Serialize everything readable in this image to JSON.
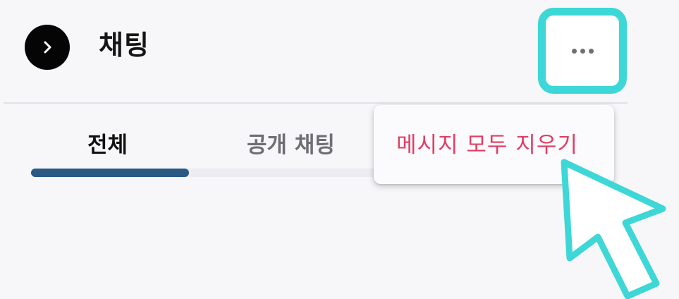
{
  "header": {
    "title": "채팅",
    "collapse_icon": "chevron-right-icon",
    "more_icon": "more-horizontal-icon"
  },
  "tabs": [
    {
      "label": "전체",
      "active": true
    },
    {
      "label": "공개 채팅",
      "active": false
    }
  ],
  "menu": {
    "items": [
      {
        "label": "메시지 모두 지우기",
        "color": "#e23d63"
      }
    ]
  },
  "annotations": {
    "highlight_color": "#3ed7d7",
    "cursor_icon": "pointer-cursor-icon"
  },
  "colors": {
    "background": "#f7f7fa",
    "active_tab_indicator": "#2a5a84",
    "destructive": "#e23d63"
  }
}
